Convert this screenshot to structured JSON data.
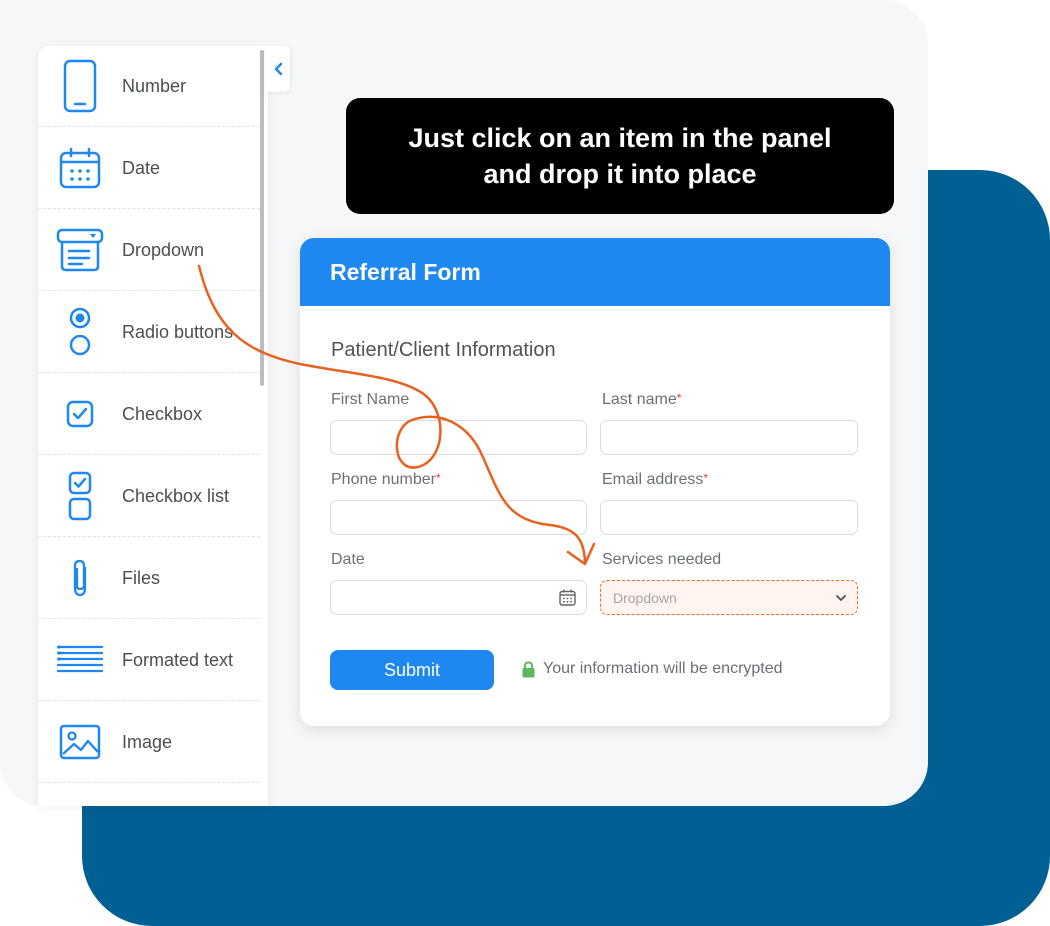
{
  "panel": {
    "items": [
      {
        "label": "Number",
        "icon": "phone-icon"
      },
      {
        "label": "Date",
        "icon": "calendar-icon"
      },
      {
        "label": "Dropdown",
        "icon": "dropdown-icon"
      },
      {
        "label": "Radio buttons",
        "icon": "radio-icon"
      },
      {
        "label": "Checkbox",
        "icon": "checkbox-icon"
      },
      {
        "label": "Checkbox list",
        "icon": "checkbox-list-icon"
      },
      {
        "label": "Files",
        "icon": "paperclip-icon"
      },
      {
        "label": "Formated text",
        "icon": "formatted-text-icon"
      },
      {
        "label": "Image",
        "icon": "image-icon"
      }
    ]
  },
  "tooltip": {
    "line1": "Just click on an item in the panel",
    "line2": "and drop it into place"
  },
  "form": {
    "title": "Referral Form",
    "section": "Patient/Client Information",
    "first_name_label": "First Name",
    "last_name_label": "Last name",
    "phone_label": "Phone number",
    "email_label": "Email address",
    "date_label": "Date",
    "services_label": "Services needed",
    "dropdown_placeholder": "Dropdown",
    "required_mark": "*",
    "submit_label": "Submit",
    "encrypt_note": "Your information will be encrypted"
  },
  "colors": {
    "accent": "#1e88f0",
    "dark_blue": "#005f93",
    "drop_highlight": "#ee6a2c",
    "lock": "#5cb85c"
  }
}
